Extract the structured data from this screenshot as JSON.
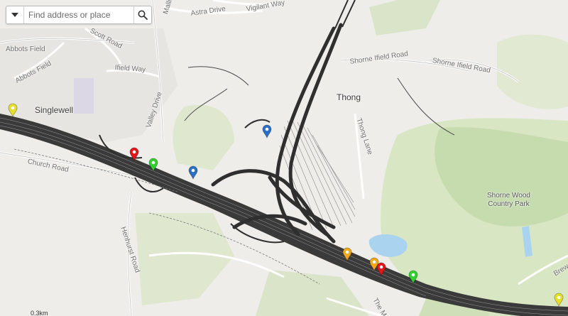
{
  "search": {
    "placeholder": "Find address or place",
    "menu_icon": "caret-down-icon",
    "search_icon": "magnifier-icon"
  },
  "labels": {
    "singlewell": "Singlewell",
    "thong": "Thong",
    "shorne_wood": "Shorne Wood",
    "country_park": "Country Park",
    "abbots_field_1": "Abbots Field",
    "abbots_field_2": "Abbots Field",
    "scott_road": "Scott Road",
    "ifield_way": "Ifield Way",
    "valley_drive": "Valley Drive",
    "astra_drive": "Astra Drive",
    "vigilant_way": "Vigilant Way",
    "shorne_ifield_road_1": "Shorne Ifield Road",
    "shorne_ifield_road_2": "Shorne Ifield Road",
    "thong_lane": "Thong Lane",
    "church_road": "Church Road",
    "henhurst_road": "Henhurst Road",
    "the_m": "The M",
    "brew": "Brew",
    "malling": "Mallin"
  },
  "scale": {
    "text": "0.3km"
  },
  "markers": [
    {
      "name": "yellow-marker-singlewell",
      "color": "#e6df2a",
      "icon": "map-pin-icon"
    },
    {
      "name": "red-marker-west",
      "color": "#e3151b",
      "icon": "map-pin-icon"
    },
    {
      "name": "green-marker-west",
      "color": "#2fd12f",
      "icon": "map-pin-icon"
    },
    {
      "name": "blue-marker-west",
      "color": "#2a6fc4",
      "icon": "map-pin-icon"
    },
    {
      "name": "blue-marker-north",
      "color": "#2a6fc4",
      "icon": "map-pin-icon"
    },
    {
      "name": "orange-marker-1",
      "color": "#f0a81d",
      "icon": "map-pin-icon"
    },
    {
      "name": "orange-marker-2",
      "color": "#f0a81d",
      "icon": "map-pin-icon"
    },
    {
      "name": "red-marker-east",
      "color": "#e3151b",
      "icon": "map-pin-icon"
    },
    {
      "name": "green-marker-east",
      "color": "#2fd12f",
      "icon": "map-pin-icon"
    },
    {
      "name": "yellow-marker-east",
      "color": "#e6df2a",
      "icon": "map-pin-icon"
    }
  ]
}
